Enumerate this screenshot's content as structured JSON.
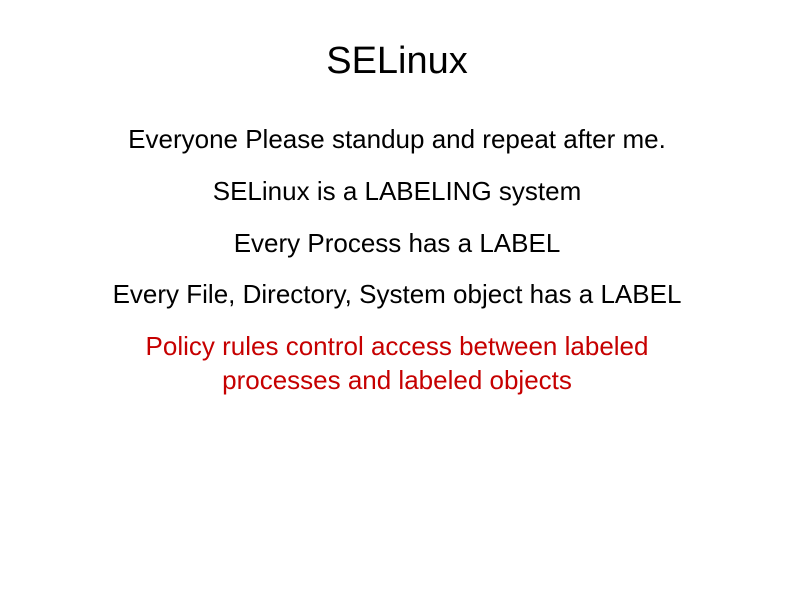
{
  "slide": {
    "title": "SELinux",
    "line1": "Everyone Please standup and repeat after me.",
    "line2": "SELinux is a LABELING system",
    "line3": "Every Process has a LABEL",
    "line4": "Every File, Directory, System object has a LABEL",
    "line5": "Policy rules control access between labeled processes and labeled objects"
  }
}
